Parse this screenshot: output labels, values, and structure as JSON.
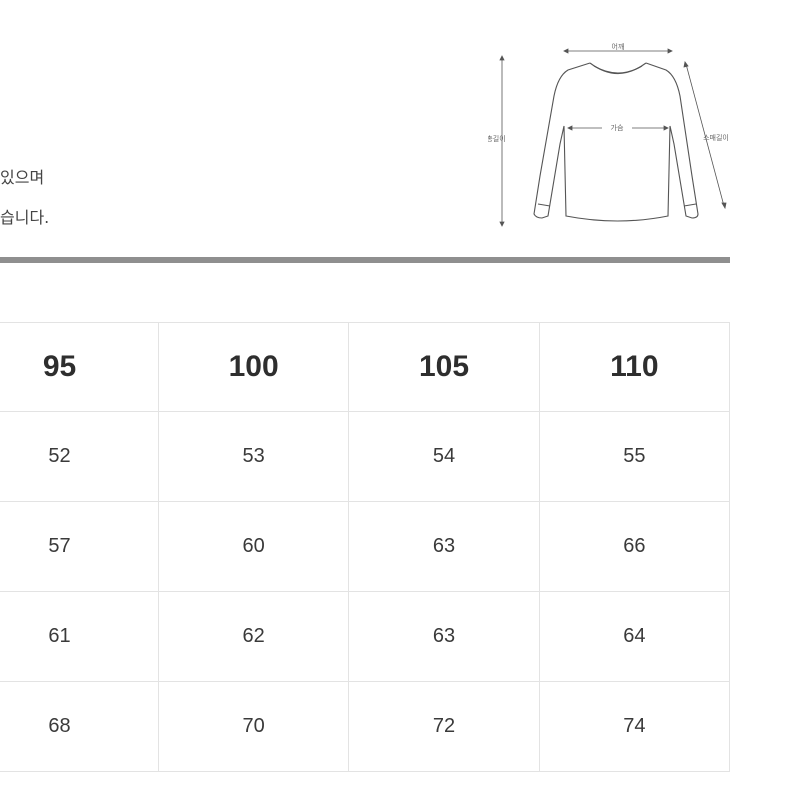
{
  "notes": [
    "있으며",
    "습니다."
  ],
  "diagram_labels": {
    "shoulder": "어깨",
    "chest": "가슴",
    "length": "총길이",
    "sleeve": "소매길이"
  },
  "table": {
    "headers": [
      "95",
      "100",
      "105",
      "110"
    ],
    "rows": [
      [
        "52",
        "53",
        "54",
        "55"
      ],
      [
        "57",
        "60",
        "63",
        "66"
      ],
      [
        "61",
        "62",
        "63",
        "64"
      ],
      [
        "68",
        "70",
        "72",
        "74"
      ]
    ]
  }
}
